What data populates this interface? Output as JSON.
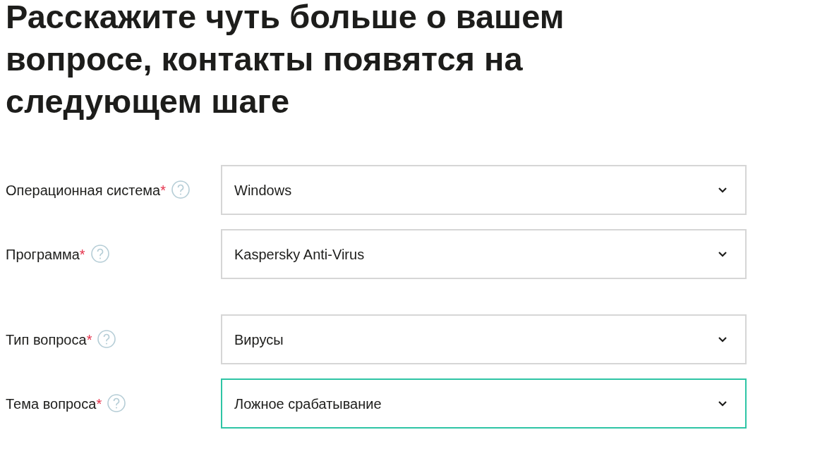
{
  "heading": "Расскажите чуть больше о вашем вопросе, контакты появятся на следующем шаге",
  "groups": [
    {
      "fields": [
        {
          "label": "Операционная система",
          "required_mark": "*",
          "value": "Windows",
          "focused": false
        },
        {
          "label": "Программа",
          "required_mark": "*",
          "value": "Kaspersky Anti-Virus",
          "focused": false
        }
      ]
    },
    {
      "fields": [
        {
          "label": "Тип вопроса",
          "required_mark": "*",
          "value": "Вирусы",
          "focused": false
        },
        {
          "label": "Тема вопроса",
          "required_mark": "*",
          "value": "Ложное срабатывание",
          "focused": true
        }
      ]
    }
  ]
}
